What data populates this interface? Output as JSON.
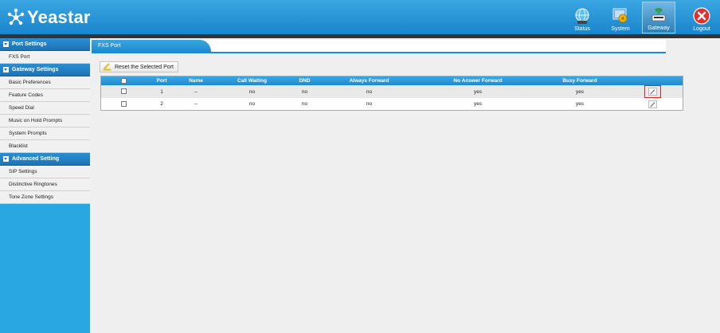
{
  "header": {
    "logo_text": "Yeastar",
    "nav": [
      {
        "label": "Status"
      },
      {
        "label": "System"
      },
      {
        "label": "Gateway"
      },
      {
        "label": "Logout"
      }
    ]
  },
  "sidebar": {
    "sections": [
      {
        "title": "Port Settings",
        "items": [
          "FXS Port"
        ]
      },
      {
        "title": "Gateway Settings",
        "items": [
          "Basic Preferences",
          "Feature Codes",
          "Speed Dial",
          "Music on Hold Prompts",
          "System Prompts",
          "Blacklist"
        ]
      },
      {
        "title": "Advanced Setting",
        "items": [
          "SIP Settings",
          "Distinctive Ringtones",
          "Tone Zone Settings"
        ]
      }
    ]
  },
  "main": {
    "title": "FXS Port",
    "reset_label": "Reset the Selected Port",
    "columns": [
      "Port",
      "Name",
      "Call Waiting",
      "DND",
      "Always Forward",
      "No Answer Forward",
      "Busy Forward"
    ],
    "rows": [
      {
        "port": "1",
        "name": "--",
        "call_waiting": "no",
        "dnd": "no",
        "always_forward": "no",
        "no_answer_forward": "yes",
        "busy_forward": "yes"
      },
      {
        "port": "2",
        "name": "--",
        "call_waiting": "no",
        "dnd": "no",
        "always_forward": "no",
        "no_answer_forward": "yes",
        "busy_forward": "yes"
      }
    ]
  },
  "colors": {
    "brand_blue": "#28a7e3",
    "header_dark": "#1a86cc",
    "highlight_red": "#e02020"
  },
  "icons": {
    "status": "globe-icon",
    "system": "monitor-icon",
    "gateway": "phone-gateway-icon",
    "logout": "close-circle-icon",
    "edit": "pencil-icon"
  }
}
